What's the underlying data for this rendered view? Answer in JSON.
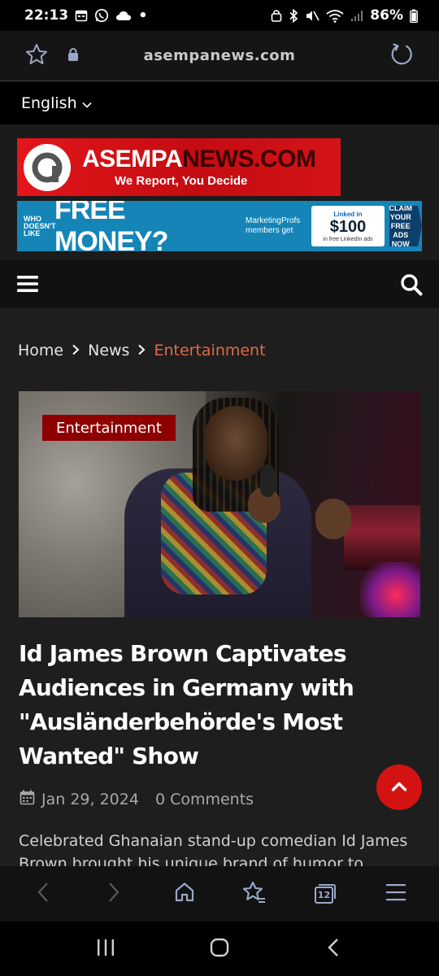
{
  "status_bar": {
    "time": "22:13",
    "battery": "86%"
  },
  "browser": {
    "url": "asempanews.com"
  },
  "language": {
    "selected": "English"
  },
  "logo": {
    "name_light": "ASEMPA",
    "name_dark": "NEWS.COM",
    "tagline": "We Report, You Decide"
  },
  "ad": {
    "who": "WHO DOESN'T LIKE",
    "headline": "FREE MONEY?",
    "subtext": "MarketingProfs members get",
    "box_brand": "Linked in",
    "box_amount": "$100",
    "box_sub": "in free LinkedIn ads",
    "cta": "CLAIM YOUR FREE ADS NOW"
  },
  "breadcrumb": {
    "items": [
      "Home",
      "News",
      "Entertainment"
    ]
  },
  "article": {
    "category": "Entertainment",
    "title": "Id James Brown Captivates Audiences in Germany with \"Ausländerbehörde's Most Wanted\" Show",
    "date": "Jan 29, 2024",
    "comments": "0 Comments",
    "excerpt": "Celebrated Ghanaian stand-up comedian Id James Brown brought his unique brand of humor to"
  },
  "icons": {
    "star": "star-icon",
    "lock": "lock-icon",
    "reload": "reload-icon",
    "menu": "hamburger-icon",
    "search": "search-icon",
    "calendar": "calendar-icon",
    "up": "chevron-up-icon"
  },
  "colors": {
    "accent_red": "#d31212",
    "badge_red": "#8e0000",
    "breadcrumb_active": "#e06a45",
    "logo_red": "#e3161b",
    "ad_blue": "#1585b8"
  },
  "toolbar": {
    "tab_count": "12"
  }
}
